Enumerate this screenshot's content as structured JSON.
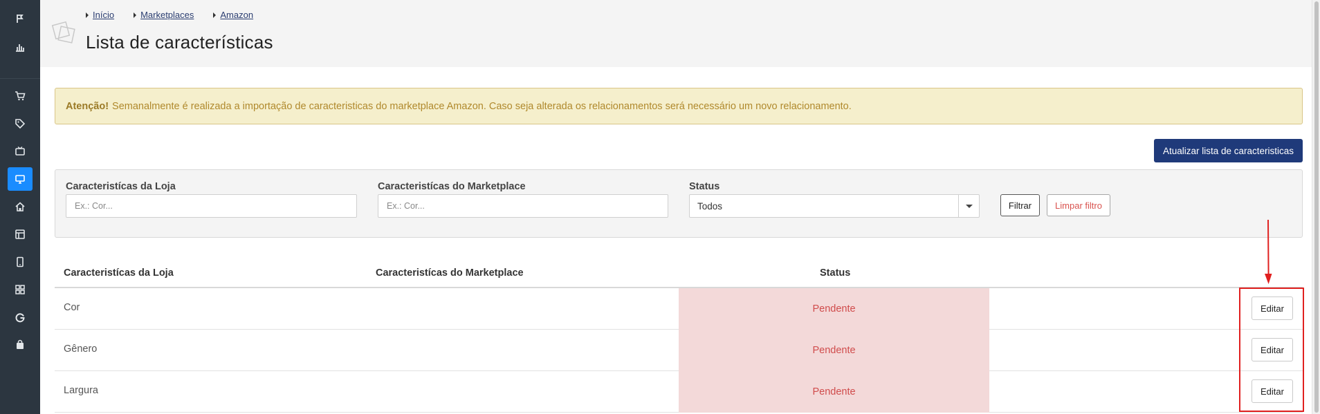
{
  "sidebar": {
    "items": [
      {
        "icon": "flag-icon"
      },
      {
        "icon": "bar-chart-icon"
      },
      {
        "icon": "cart-icon"
      },
      {
        "icon": "tag-icon"
      },
      {
        "icon": "tv-icon"
      },
      {
        "icon": "monitor-icon",
        "active": true
      },
      {
        "icon": "home-icon"
      },
      {
        "icon": "layout-icon"
      },
      {
        "icon": "mobile-icon"
      },
      {
        "icon": "grid-icon"
      },
      {
        "icon": "google-icon"
      },
      {
        "icon": "bag-icon"
      }
    ],
    "active_color": "#1a8cff",
    "background": "#2c3640"
  },
  "header": {
    "breadcrumbs": [
      "Início",
      "Marketplaces",
      "Amazon"
    ],
    "title": "Lista de características"
  },
  "alert": {
    "strong": "Atenção!",
    "text": "Semanalmente é realizada a importação de caracteristicas do marketplace Amazon. Caso seja alterada os relacionamentos será necessário um novo relacionamento."
  },
  "update_button": "Atualizar lista de caracteristicas",
  "filter": {
    "store_label": "Caracteristícas da Loja",
    "store_placeholder": "Ex.: Cor...",
    "marketplace_label": "Caracteristícas do Marketplace",
    "marketplace_placeholder": "Ex.: Cor...",
    "status_label": "Status",
    "status_value": "Todos",
    "filter_button": "Filtrar",
    "clear_button": "Limpar filtro"
  },
  "table": {
    "headers": [
      "Caracteristícas da Loja",
      "Caracteristícas do Marketplace",
      "Status"
    ],
    "rows": [
      {
        "store": "Cor",
        "marketplace": "",
        "status": "Pendente",
        "action": "Editar"
      },
      {
        "store": "Gênero",
        "marketplace": "",
        "status": "Pendente",
        "action": "Editar"
      },
      {
        "store": "Largura",
        "marketplace": "",
        "status": "Pendente",
        "action": "Editar"
      }
    ]
  },
  "colors": {
    "primary_button": "#1f3a7a",
    "alert_bg": "#f5efcc",
    "status_pending_bg": "#f3d9d9",
    "status_pending_text": "#d04c4c",
    "annotation": "#e0201f"
  }
}
